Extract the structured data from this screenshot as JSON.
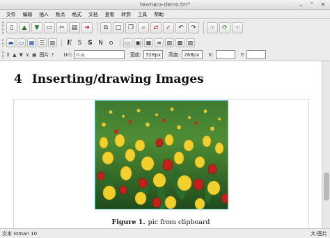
{
  "window": {
    "title": "texmacs-demo.tm*"
  },
  "menu": [
    "文件",
    "编辑",
    "插入",
    "焦点",
    "格式",
    "文档",
    "查看",
    "转到",
    "工具",
    "帮助"
  ],
  "toolbar_main": {
    "icons": [
      "new-document-icon",
      "open-icon",
      "save-icon",
      "print-icon",
      "cut-icon",
      "paste-icon",
      "export-icon",
      "copy-icon",
      "window-icon",
      "duplicate-icon",
      "search-icon",
      "replace-icon",
      "spellcheck-icon",
      "undo-icon",
      "redo-icon",
      "scheme-icon",
      "session-icon",
      "hand-icon"
    ]
  },
  "toolbar_format": {
    "buttons": [
      "E",
      "S",
      "S",
      "N",
      "O"
    ],
    "icons": [
      "format-block-icon",
      "format-window-icon",
      "format-table-icon",
      "format-list-icon",
      "format-paragraph-icon",
      "italic-E-icon",
      "sans-icon",
      "sans-bold-icon",
      "small-caps-icon",
      "outline-icon",
      "ruler-icon",
      "frame-icon",
      "grid-icon",
      "list-icon",
      "image-icon"
    ]
  },
  "image_bar": {
    "image_label": "图片",
    "help": "?",
    "url_label": "Url:",
    "url_value": "n.a.",
    "width_label": "宽度:",
    "width_value": "328px",
    "height_label": "高度:",
    "height_value": "268px",
    "x_label": "X:",
    "x_value": "",
    "y_label": "Y:",
    "y_value": ""
  },
  "document": {
    "section_number": "4",
    "section_title": "Inserting/drawing Images",
    "figure_label": "Figure 1.",
    "figure_caption": "pic from clipboard"
  },
  "status": {
    "left": "文本 roman 10",
    "right": "大-图片"
  }
}
